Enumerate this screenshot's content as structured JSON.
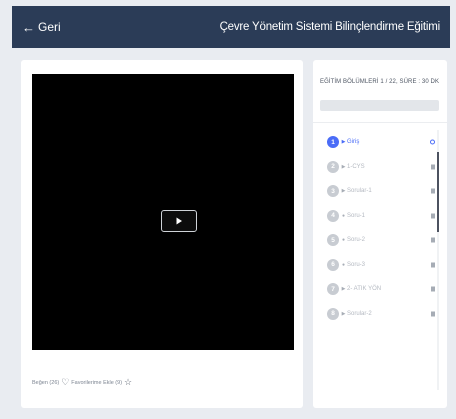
{
  "header": {
    "back_label": "Geri",
    "back_icon": "arrow-left-icon",
    "course_title": "Çevre Yönetim Sistemi Bilinçlendirme Eğitimi"
  },
  "player": {
    "play_icon": "play-icon",
    "like_label": "Beğen (26)",
    "favorite_label": "Favorilerime Ekle (9)",
    "heart_icon": "heart-icon",
    "star_icon": "star-icon"
  },
  "sections": {
    "title": "EĞİTİM BÖLÜMLERİ   1 / 22, SÜRE : 30 DK",
    "progress_fraction": 0.0,
    "items": [
      {
        "number": "1",
        "label": "Giriş",
        "icon": "play-icon",
        "icon_char": "▶",
        "active": true,
        "status": "in-progress-ring"
      },
      {
        "number": "2",
        "label": "1-CYS",
        "icon": "play-icon",
        "icon_char": "▶",
        "active": false,
        "status": "locked"
      },
      {
        "number": "3",
        "label": "Sorular-1",
        "icon": "play-icon",
        "icon_char": "▶",
        "active": false,
        "status": "locked"
      },
      {
        "number": "4",
        "label": "Soru-1",
        "icon": "question-dot-icon",
        "icon_char": "●",
        "active": false,
        "status": "locked"
      },
      {
        "number": "5",
        "label": "Soru-2",
        "icon": "question-dot-icon",
        "icon_char": "●",
        "active": false,
        "status": "locked"
      },
      {
        "number": "6",
        "label": "Soru-3",
        "icon": "question-dot-icon",
        "icon_char": "●",
        "active": false,
        "status": "locked"
      },
      {
        "number": "7",
        "label": "2- ATIK YÖN",
        "icon": "play-icon",
        "icon_char": "▶",
        "active": false,
        "status": "locked"
      },
      {
        "number": "8",
        "label": "Sorular-2",
        "icon": "play-icon",
        "icon_char": "▶",
        "active": false,
        "status": "locked"
      }
    ]
  },
  "colors": {
    "header_bg": "#2b3c57",
    "accent": "#4a6cf7",
    "page_bg": "#e9ecf1"
  }
}
